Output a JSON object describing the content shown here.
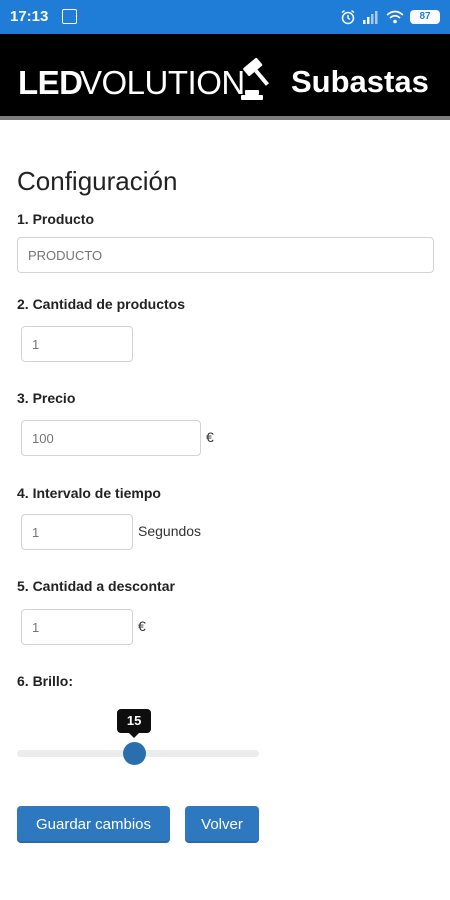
{
  "status_bar": {
    "time": "17:13",
    "battery": "87",
    "icons": [
      "image-icon",
      "alarm-icon",
      "signal-icon",
      "wifi-icon",
      "battery-icon"
    ]
  },
  "header": {
    "brand_bold": "LED",
    "brand_light": "VOLUTION",
    "logo_icon": "gavel-icon",
    "subtitle": "Subastas"
  },
  "form": {
    "title": "Configuración",
    "product": {
      "label": "1. Producto",
      "placeholder": "PRODUCTO"
    },
    "quantity": {
      "label": "2. Cantidad de productos",
      "placeholder": "1"
    },
    "price": {
      "label": "3. Precio",
      "placeholder": "100",
      "suffix": "€"
    },
    "interval": {
      "label": "4. Intervalo de tiempo",
      "placeholder": "1",
      "suffix": "Segundos"
    },
    "discount": {
      "label": "5. Cantidad a descontar",
      "placeholder": "1",
      "suffix": "€"
    },
    "brightness": {
      "label": "6. Brillo:",
      "value": 15,
      "min": 0,
      "max": 31
    }
  },
  "buttons": {
    "save": "Guardar cambios",
    "back": "Volver"
  },
  "colors": {
    "status_bar": "#1f7dd8",
    "banner": "#000000",
    "accent": "#2e78c0"
  }
}
